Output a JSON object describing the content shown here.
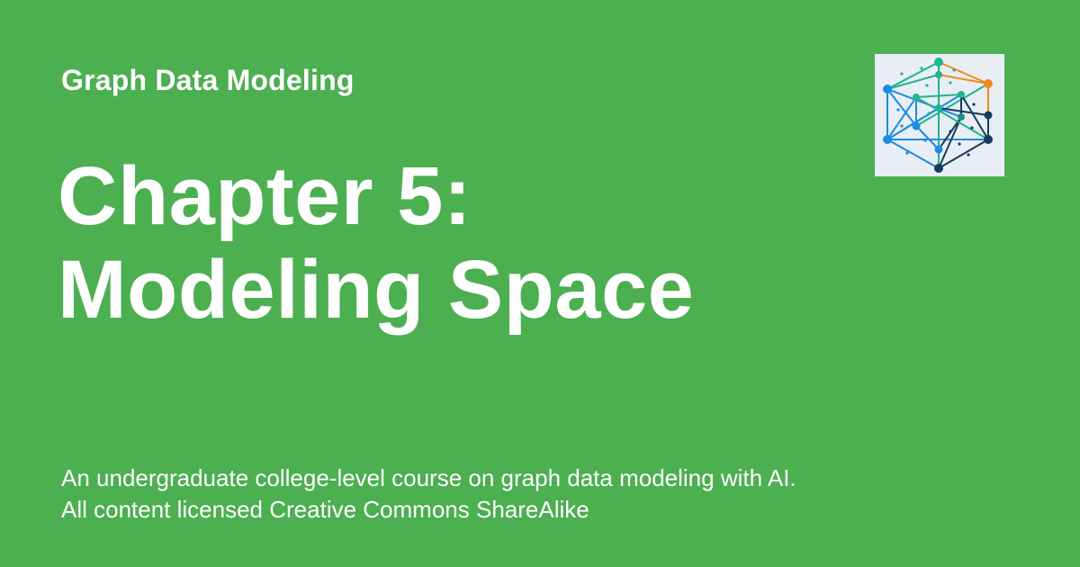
{
  "card": {
    "site_name": "Graph Data Modeling",
    "title_line_1": "Chapter 5:",
    "title_line_2": "Modeling Space",
    "description": "An undergraduate college-level course on graph data modeling with AI. All content licensed Creative Commons ShareAlike",
    "logo_icon": "graph-network-logo-icon"
  },
  "colors": {
    "background": "#4caf50",
    "text": "#ffffff",
    "logo_background": "#e8eef3",
    "logo_teal": "#1fb58f",
    "logo_blue": "#1e8be0",
    "logo_navy": "#173a5c",
    "logo_orange": "#f08a1c"
  }
}
